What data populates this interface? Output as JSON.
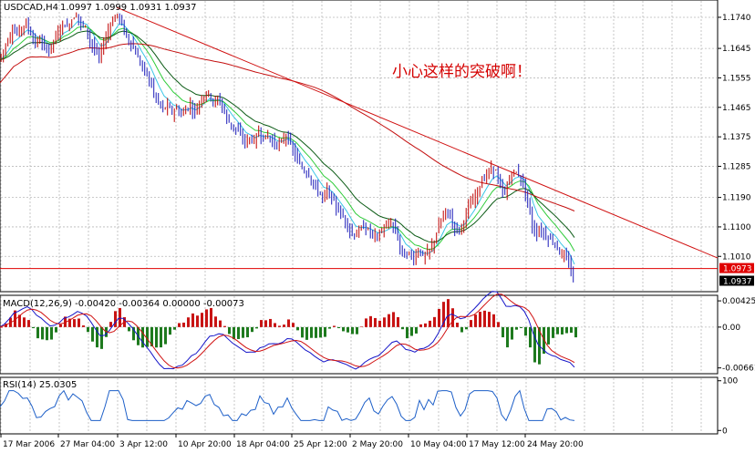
{
  "chart_data": {
    "type": "line",
    "symbol_label": "USDCAD,H4",
    "ohlc_label": "1.0997 1.0999 1.0931 1.0937",
    "annotation": "小心这样的突破啊！",
    "price_axis": {
      "ticks": [
        "1.1740",
        "1.1645",
        "1.1555",
        "1.1465",
        "1.1375",
        "1.1285",
        "1.1190",
        "1.1100",
        "1.1010"
      ],
      "range": [
        1.0905,
        1.179
      ],
      "hline_label": "1.0973",
      "hline_value": 1.0973,
      "last_label": "1.0937",
      "last_value": 1.0937
    },
    "time_axis": {
      "labels": [
        "17 Mar 2006",
        "27 Mar 04:00",
        "3 Apr 12:00",
        "10 Apr 20:00",
        "18 Apr 04:00",
        "25 Apr 12:00",
        "2 May 20:00",
        "10 May 04:00",
        "17 May 12:00",
        "24 May 20:00"
      ]
    },
    "close_path": [
      [
        0,
        1.161
      ],
      [
        5,
        1.164
      ],
      [
        10,
        1.167
      ],
      [
        15,
        1.17
      ],
      [
        20,
        1.169
      ],
      [
        25,
        1.171
      ],
      [
        30,
        1.172
      ],
      [
        35,
        1.169
      ],
      [
        40,
        1.166
      ],
      [
        45,
        1.167
      ],
      [
        50,
        1.165
      ],
      [
        55,
        1.164
      ],
      [
        60,
        1.167
      ],
      [
        65,
        1.169
      ],
      [
        70,
        1.172
      ],
      [
        75,
        1.171
      ],
      [
        80,
        1.173
      ],
      [
        85,
        1.175
      ],
      [
        90,
        1.172
      ],
      [
        95,
        1.171
      ],
      [
        100,
        1.167
      ],
      [
        105,
        1.164
      ],
      [
        110,
        1.162
      ],
      [
        115,
        1.166
      ],
      [
        120,
        1.17
      ],
      [
        125,
        1.173
      ],
      [
        130,
        1.175
      ],
      [
        135,
        1.172
      ],
      [
        140,
        1.168
      ],
      [
        145,
        1.166
      ],
      [
        150,
        1.163
      ],
      [
        155,
        1.16
      ],
      [
        160,
        1.158
      ],
      [
        165,
        1.155
      ],
      [
        170,
        1.151
      ],
      [
        175,
        1.148
      ],
      [
        180,
        1.146
      ],
      [
        185,
        1.147
      ],
      [
        190,
        1.145
      ],
      [
        195,
        1.146
      ],
      [
        200,
        1.144
      ],
      [
        205,
        1.146
      ],
      [
        210,
        1.147
      ],
      [
        215,
        1.145
      ],
      [
        220,
        1.148
      ],
      [
        225,
        1.15
      ],
      [
        230,
        1.151
      ],
      [
        235,
        1.148
      ],
      [
        240,
        1.149
      ],
      [
        245,
        1.147
      ],
      [
        250,
        1.143
      ],
      [
        255,
        1.141
      ],
      [
        260,
        1.14
      ],
      [
        265,
        1.138
      ],
      [
        270,
        1.136
      ],
      [
        275,
        1.137
      ],
      [
        280,
        1.136
      ],
      [
        285,
        1.139
      ],
      [
        290,
        1.137
      ],
      [
        295,
        1.138
      ],
      [
        300,
        1.136
      ],
      [
        305,
        1.135
      ],
      [
        310,
        1.136
      ],
      [
        315,
        1.138
      ],
      [
        320,
        1.135
      ],
      [
        325,
        1.132
      ],
      [
        330,
        1.129
      ],
      [
        335,
        1.127
      ],
      [
        340,
        1.126
      ],
      [
        345,
        1.123
      ],
      [
        350,
        1.121
      ],
      [
        355,
        1.119
      ],
      [
        360,
        1.121
      ],
      [
        365,
        1.119
      ],
      [
        370,
        1.116
      ],
      [
        375,
        1.114
      ],
      [
        380,
        1.112
      ],
      [
        385,
        1.109
      ],
      [
        390,
        1.107
      ],
      [
        395,
        1.109
      ],
      [
        400,
        1.11
      ],
      [
        405,
        1.109
      ],
      [
        410,
        1.108
      ],
      [
        415,
        1.107
      ],
      [
        420,
        1.109
      ],
      [
        425,
        1.11
      ],
      [
        430,
        1.111
      ],
      [
        435,
        1.109
      ],
      [
        440,
        1.104
      ],
      [
        445,
        1.101
      ],
      [
        450,
        1.102
      ],
      [
        455,
        1.1
      ],
      [
        460,
        1.103
      ],
      [
        465,
        1.101
      ],
      [
        470,
        1.102
      ],
      [
        475,
        1.104
      ],
      [
        480,
        1.108
      ],
      [
        485,
        1.112
      ],
      [
        490,
        1.115
      ],
      [
        495,
        1.113
      ],
      [
        500,
        1.11
      ],
      [
        505,
        1.109
      ],
      [
        510,
        1.112
      ],
      [
        515,
        1.116
      ],
      [
        520,
        1.118
      ],
      [
        525,
        1.121
      ],
      [
        530,
        1.124
      ],
      [
        535,
        1.126
      ],
      [
        540,
        1.128
      ],
      [
        545,
        1.127
      ],
      [
        550,
        1.122
      ],
      [
        555,
        1.12
      ],
      [
        560,
        1.125
      ],
      [
        565,
        1.127
      ],
      [
        570,
        1.126
      ],
      [
        575,
        1.123
      ],
      [
        580,
        1.118
      ],
      [
        585,
        1.11
      ],
      [
        590,
        1.108
      ],
      [
        595,
        1.109
      ],
      [
        600,
        1.107
      ],
      [
        605,
        1.106
      ],
      [
        610,
        1.105
      ],
      [
        615,
        1.102
      ],
      [
        620,
        1.101
      ],
      [
        625,
        1.099
      ],
      [
        630,
        1.094
      ]
    ],
    "macd_label": "MACD(12,26,9) -0.00420 -0.00364 0.00000 -0.00073",
    "macd_axis": {
      "ticks": [
        "0.00425",
        "0.00",
        "-0.00661"
      ],
      "range": [
        -0.0074,
        0.005
      ]
    },
    "rsi_label": "RSI(14) 25.0305",
    "rsi_axis": {
      "ticks": [
        "100",
        "0"
      ],
      "range": [
        -5,
        105
      ]
    }
  }
}
